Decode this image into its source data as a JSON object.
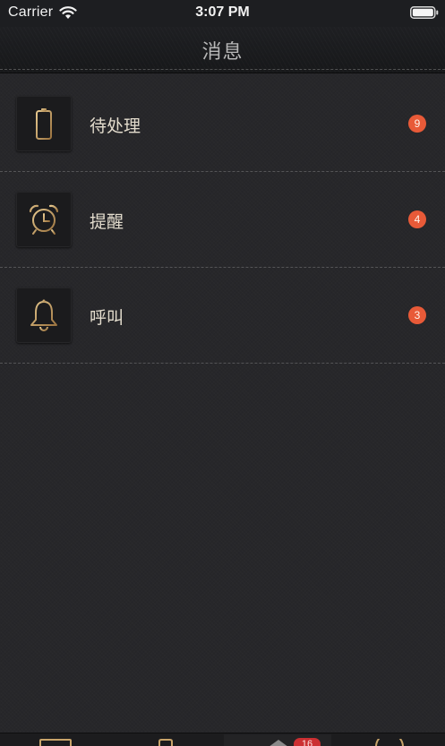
{
  "status_bar": {
    "carrier": "Carrier",
    "time": "3:07 PM",
    "wifi_icon": "wifi-icon",
    "battery_icon": "battery-icon"
  },
  "nav": {
    "title": "消息"
  },
  "messages": [
    {
      "label": "待处理",
      "icon": "phone-icon",
      "badge": "9"
    },
    {
      "label": "提醒",
      "icon": "alarm-clock-icon",
      "badge": "4"
    },
    {
      "label": "呼叫",
      "icon": "bell-icon",
      "badge": "3"
    }
  ],
  "tab_bar": {
    "badge": "16",
    "items": [
      "monitor-icon",
      "phone-icon",
      "home-icon",
      "clock-icon"
    ]
  },
  "colors": {
    "background": "#27272a",
    "accent_gold": "#c9a46a",
    "badge": "#e85a38",
    "tab_badge": "#cc2f32"
  }
}
